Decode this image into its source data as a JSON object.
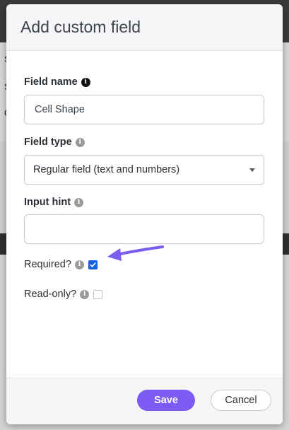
{
  "modal": {
    "title": "Add custom field"
  },
  "backdrop": {
    "letters": [
      "S",
      "S",
      "C"
    ]
  },
  "fields": {
    "field_name": {
      "label": "Field name",
      "value": "Cell Shape"
    },
    "field_type": {
      "label": "Field type",
      "selected": "Regular field (text and numbers)"
    },
    "input_hint": {
      "label": "Input hint",
      "value": ""
    },
    "required": {
      "label": "Required?",
      "checked": true
    },
    "read_only": {
      "label": "Read-only?",
      "checked": false
    }
  },
  "footer": {
    "save_label": "Save",
    "cancel_label": "Cancel"
  },
  "colors": {
    "accent": "#7c5cf2",
    "checkbox": "#1a5fe0",
    "arrow": "#7a5cf0"
  },
  "icons": [
    "info-icon",
    "chevron-down-icon",
    "arrow-icon",
    "check-icon"
  ]
}
